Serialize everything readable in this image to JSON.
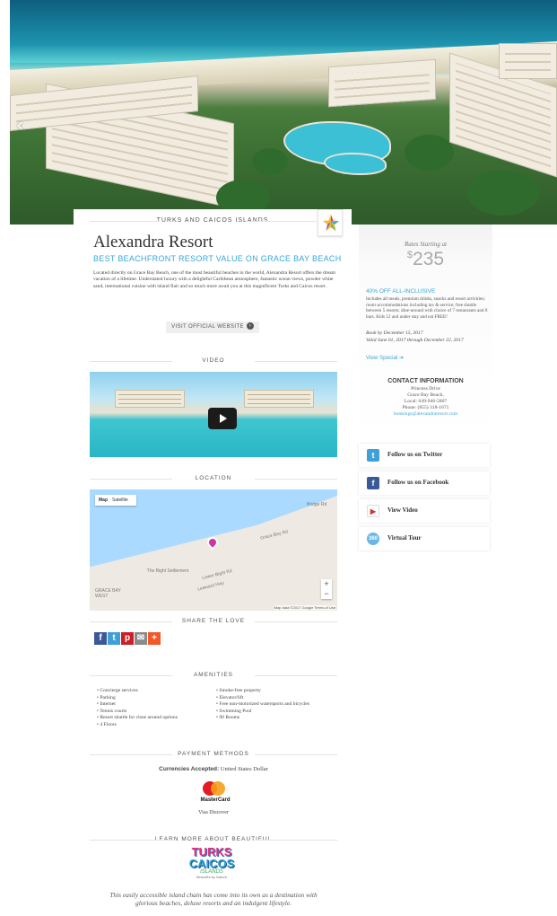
{
  "resort": {
    "region": "TURKS AND CAICOS ISLANDS",
    "name": "Alexandra Resort",
    "tagline": "BEST BEACHFRONT RESORT VALUE ON GRACE BAY BEACH",
    "description": "Located directly on Grace Bay Beach, one of the most beautiful beaches in the world, Alexandra Resort offers the dream vacation of a lifetime. Understated luxury with a delightful Caribbean atmosphere, fantastic ocean views, powder white sand, international cuisine with island flair and so much more await you at this magnificent Turks and Caicos resort.",
    "official_button": "VISIT OFFICIAL WEBSITE"
  },
  "sections": {
    "video": "VIDEO",
    "location": "LOCATION",
    "share": "SHARE THE LOVE",
    "amenities": "AMENITIES",
    "payment": "PAYMENT METHODS",
    "learn_more": "LEARN MORE ABOUT BEAUTIFUL"
  },
  "map": {
    "type_map": "Map",
    "type_satellite": "Satellite",
    "labels": [
      "Grace Bay Rd",
      "The Bight Settlement",
      "GRACE BAY WEST",
      "Lower Bight Rd",
      "Leeward Hwy",
      "Bridge Rd"
    ],
    "footer": "Map data ©2017 Google  Terms of Use",
    "zoom_in": "+",
    "zoom_out": "−"
  },
  "amenities": {
    "left": [
      "Concierge services",
      "Parking",
      "Internet",
      "Tennis courts",
      "Resort shuttle for close around options",
      "4 Floors"
    ],
    "right": [
      "Smoke-free property",
      "Elevator/lift",
      "Free non-motorized watersports and bicycles",
      "Swimming Pool",
      "90 Rooms"
    ]
  },
  "payment": {
    "currency_label": "Currencies Accepted:",
    "currency_value": "United States Dollar",
    "card_brand": "MasterCard",
    "other_cards": "Visa    Discover"
  },
  "tci_logo": {
    "line1": "TURKS",
    "line2": "CAICOS",
    "line3": "ISLANDS",
    "line4": "Beautiful by Nature"
  },
  "closing": "This easily accessible island chain has come into its own as a destination with glorious beaches, deluxe resorts and an indulgent lifestyle.",
  "rates": {
    "label": "Rates Starting at",
    "currency": "$",
    "amount": "235"
  },
  "special": {
    "title": "40% OFF ALL-INCLUSIVE",
    "body": "Includes all meals, premium drinks, snacks and resort activities; room accommodations including tax & service; free shuttle between 5 resorts; dine-around with choice of 7 restaurants and 8 bars. Kids 12 and under stay and eat FREE!",
    "book_by": "Book by December 15, 2017",
    "valid": "Valid June 01, 2017 through December 22, 2017",
    "link": "View Special"
  },
  "contact": {
    "title": "CONTACT INFORMATION",
    "address1": "Princess Drive",
    "address2": "Grace Bay Beach,",
    "local": "Local: 649-946-5807",
    "phone": "Phone: (855) 318-1671",
    "email": "bookings@alexandraresort.com"
  },
  "social": {
    "twitter": "Follow us on Twitter",
    "facebook": "Follow us on Facebook",
    "video": "View Video",
    "tour": "Virtual Tour"
  },
  "colors": {
    "accent": "#3aa6d9",
    "twitter": "#3ea0d6",
    "facebook": "#3b5998",
    "pinterest": "#cb2027",
    "email": "#8a8a8a",
    "addthis": "#f1592a"
  }
}
